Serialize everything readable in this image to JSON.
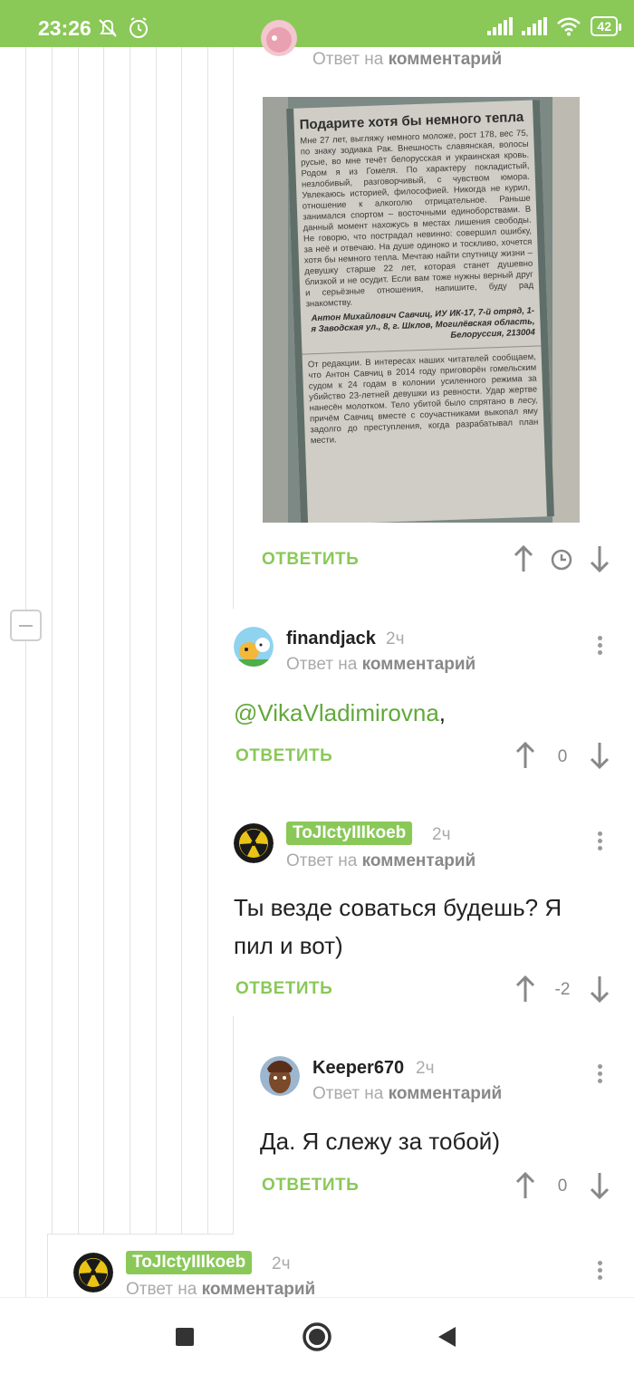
{
  "status_bar": {
    "time": "23:26",
    "battery": "42",
    "accent_color": "#8ac858"
  },
  "comments": [
    {
      "reply_prefix": "Ответ на",
      "reply_target": "комментарий",
      "reply_label": "ОТВЕТИТЬ",
      "has_image": true
    },
    {
      "username": "finandjack",
      "time": "2ч",
      "reply_prefix": "Ответ на",
      "reply_target": "комментарий",
      "mention": "@VikaVladimirovna",
      "text_after_mention": ",",
      "reply_label": "ОТВЕТИТЬ",
      "rating": "0"
    },
    {
      "username": "ToJIctyIIIkoeb",
      "time": "2ч",
      "reply_prefix": "Ответ на",
      "reply_target": "комментарий",
      "text": "Ты везде соваться будешь? Я пил и вот)",
      "reply_label": "ОТВЕТИТЬ",
      "rating": "-2"
    },
    {
      "username": "Keeper670",
      "time": "2ч",
      "reply_prefix": "Ответ на",
      "reply_target": "комментарий",
      "text": "Да. Я слежу за тобой)",
      "reply_label": "ОТВЕТИТЬ",
      "rating": "0"
    },
    {
      "username": "ToJIctyIIIkoeb",
      "time": "2ч",
      "reply_prefix": "Ответ на",
      "reply_target": "комментарий"
    }
  ],
  "newspaper": {
    "headline": "Подарите хотя бы немного тепла",
    "body": "Мне 27 лет, выгляжу немного моложе, рост 178, вес 75, по знаку зодиака Рак. Внешность славянская, волосы русые, во мне течёт белорусская и украинская кровь. Родом я из Гомеля. По характеру покладистый, незлобивый, разговорчивый, с чувством юмора. Увлекаюсь историей, философией. Никогда не курил, отношение к алкоголю отрицательное. Раньше занимался спортом – восточными единоборствами. В данный момент нахожусь в местах лишения свободы. Не говорю, что пострадал невинно: совершил ошибку, за неё и отвечаю. На душе одиноко и тоскливо, хочется хотя бы немного тепла. Мечтаю найти спутницу жизни – девушку старше 22 лет, которая станет душевно близкой и не осудит. Если вам тоже нужны верный друг и серьёзные отношения, напишите, буду рад знакомству.",
    "signature": "Антон Михайлович Савчиц, ИУ ИК-17, 7-й отряд, 1-я Заводская ул., 8, г. Шклов, Могилёвская область, Белоруссия, 213004",
    "editorial": "От редакции. В интересах наших читателей сообщаем, что Антон Савчиц в 2014 году приговорён гомельским судом к 24 годам в колонии усиленного режима за убийство 23-летней девушки из ревности. Удар жертве нанесён молотком. Тело убитой было спрятано в лесу, причём Савчиц вместе с соучастниками выкопал яму задолго до преступления, когда разрабатывал план мести."
  }
}
